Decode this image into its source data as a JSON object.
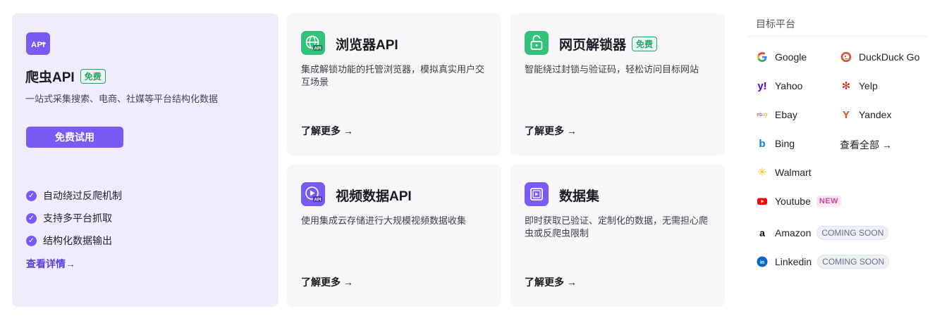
{
  "scraper": {
    "icon_label": "API",
    "title": "爬虫API",
    "badge": "免费",
    "description": "一站式采集搜索、电商、社媒等平台结构化数据",
    "cta": "免费试用",
    "features": [
      "自动绕过反爬机制",
      "支持多平台抓取",
      "结构化数据输出"
    ],
    "link": "查看详情→"
  },
  "products": [
    {
      "title": "浏览器API",
      "description": "集成解锁功能的托管浏览器，模拟真实用户交互场景",
      "link": "了解更多 →",
      "icon": "globe-api-icon"
    },
    {
      "title": "网页解锁器",
      "badge": "免费",
      "description": "智能绕过封锁与验证码，轻松访问目标网站",
      "link": "了解更多 →",
      "icon": "unlock-icon"
    },
    {
      "title": "视频数据API",
      "description": "使用集成云存储进行大规模视频数据收集",
      "link": "了解更多 →",
      "icon": "video-api-icon"
    },
    {
      "title": "数据集",
      "description": "即时获取已验证、定制化的数据，无需担心爬虫或反爬虫限制",
      "link": "了解更多 →",
      "icon": "dataset-icon"
    }
  ],
  "platforms": {
    "heading": "目标平台",
    "items": {
      "google": {
        "label": "Google",
        "icon": "google-icon"
      },
      "duckduckgo": {
        "label": "DuckDuck Go",
        "icon": "duckduckgo-icon"
      },
      "yahoo": {
        "label": "Yahoo",
        "icon": "yahoo-icon"
      },
      "yelp": {
        "label": "Yelp",
        "icon": "yelp-icon"
      },
      "ebay": {
        "label": "Ebay",
        "icon": "ebay-icon"
      },
      "yandex": {
        "label": "Yandex",
        "icon": "yandex-icon"
      },
      "bing": {
        "label": "Bing",
        "icon": "bing-icon"
      },
      "view_all": {
        "label": "查看全部 →"
      },
      "walmart": {
        "label": "Walmart",
        "icon": "walmart-icon"
      },
      "youtube": {
        "label": "Youtube",
        "tag": "NEW",
        "icon": "youtube-icon"
      },
      "amazon": {
        "label": "Amazon",
        "tag": "COMING SOON",
        "icon": "amazon-icon"
      },
      "linkedin": {
        "label": "Linkedin",
        "tag": "COMING SOON",
        "icon": "linkedin-icon"
      }
    }
  },
  "colors": {
    "accent": "#7a5af5",
    "green": "#34c27a",
    "card_main_bg": "#f1ecfc",
    "card_bg": "#f7f7f9"
  }
}
